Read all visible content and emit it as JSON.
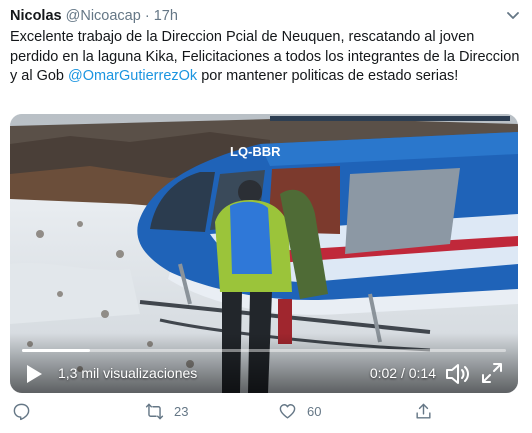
{
  "tweet": {
    "author_name": "Nicolas",
    "handle": "@Nicoacap",
    "separator": "·",
    "time": "17h",
    "text_parts": {
      "before_mention": "Excelente trabajo de la Direccion Pcial de Neuquen, rescatando al joven perdido en la laguna Kika, Felicitaciones a todos los integrantes de la Direccion y al Gob ",
      "mention": "@OmarGutierrezOk",
      "after_mention": " por mantener politicas de estado serias!"
    }
  },
  "video": {
    "views": "1,3 mil visualizaciones",
    "timer": "0:02 / 0:14",
    "progress": 0.14,
    "aircraft_registration": "LQ-BBR"
  },
  "actions": {
    "retweets": "23",
    "likes": "60"
  },
  "colors": {
    "mention": "#1b95e0",
    "meta": "#657786",
    "text": "#14171a"
  },
  "icons": [
    "chevron-down-icon",
    "play-icon",
    "volume-icon",
    "fullscreen-icon",
    "reply-icon",
    "retweet-icon",
    "like-icon",
    "share-icon"
  ]
}
